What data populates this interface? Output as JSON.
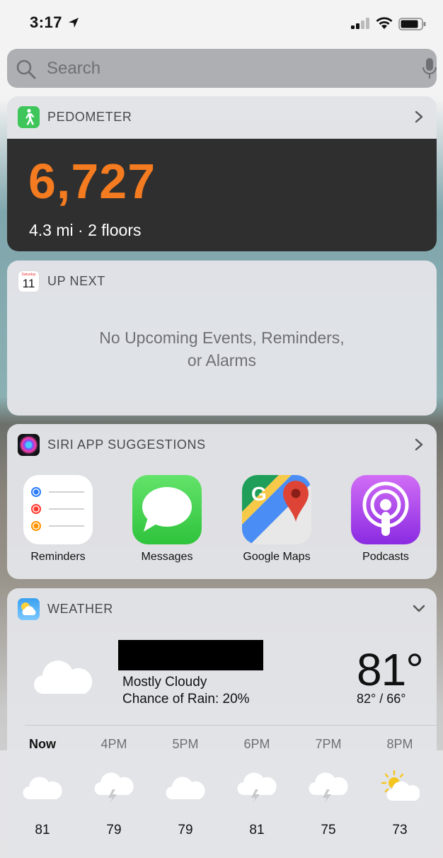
{
  "status_bar": {
    "time": "3:17"
  },
  "search": {
    "placeholder": "Search"
  },
  "pedometer": {
    "title": "PEDOMETER",
    "steps": "6,727",
    "detail": "4.3 mi · 2 floors",
    "accent": "#f47b20"
  },
  "up_next": {
    "title": "UP NEXT",
    "calendar_day": "Saturday",
    "calendar_date": "11",
    "message_line1": "No Upcoming Events, Reminders,",
    "message_line2": "or Alarms"
  },
  "siri": {
    "title": "SIRI APP SUGGESTIONS",
    "apps": [
      {
        "label": "Reminders",
        "icon": "reminders-icon"
      },
      {
        "label": "Messages",
        "icon": "messages-icon"
      },
      {
        "label": "Google Maps",
        "icon": "google-maps-icon"
      },
      {
        "label": "Podcasts",
        "icon": "podcasts-icon"
      }
    ]
  },
  "weather": {
    "title": "WEATHER",
    "condition": "Mostly Cloudy",
    "rain": "Chance of Rain: 20%",
    "temp": "81°",
    "hilo": "82° / 66°",
    "hours": [
      {
        "time": "Now",
        "icon": "cloud-icon",
        "temp": "81"
      },
      {
        "time": "4PM",
        "icon": "thunderstorm-icon",
        "temp": "79"
      },
      {
        "time": "5PM",
        "icon": "cloud-icon",
        "temp": "79"
      },
      {
        "time": "6PM",
        "icon": "thunderstorm-icon",
        "temp": "81"
      },
      {
        "time": "7PM",
        "icon": "thunderstorm-icon",
        "temp": "75"
      },
      {
        "time": "8PM",
        "icon": "partly-sunny-icon",
        "temp": "73"
      }
    ]
  }
}
